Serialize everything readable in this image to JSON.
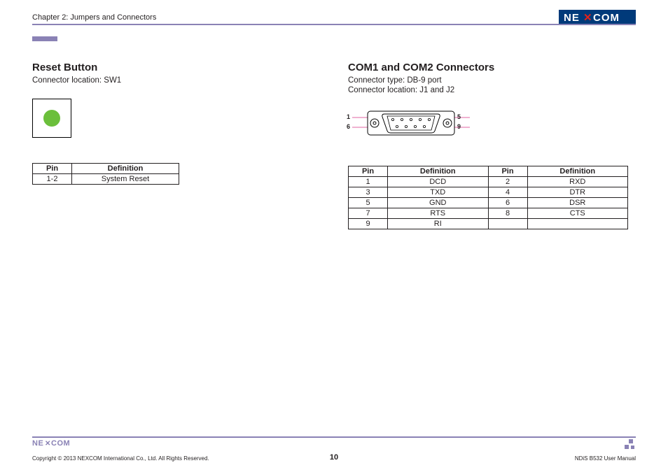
{
  "header": {
    "chapter": "Chapter 2: Jumpers and Connectors",
    "logo_text": "NEXCOM"
  },
  "left": {
    "title": "Reset Button",
    "meta1": "Connector location: SW1",
    "table": {
      "headers": [
        "Pin",
        "Definition"
      ],
      "rows": [
        {
          "pin": "1-2",
          "def": "System Reset"
        }
      ]
    }
  },
  "right": {
    "title": "COM1 and COM2 Connectors",
    "meta1": "Connector type: DB-9 port",
    "meta2": "Connector location: J1 and J2",
    "diagram_labels": {
      "tl": "1",
      "tr": "5",
      "bl": "6",
      "br": "9"
    },
    "table": {
      "headers": [
        "Pin",
        "Definition",
        "Pin",
        "Definition"
      ],
      "rows": [
        {
          "p1": "1",
          "d1": "DCD",
          "p2": "2",
          "d2": "RXD"
        },
        {
          "p1": "3",
          "d1": "TXD",
          "p2": "4",
          "d2": "DTR"
        },
        {
          "p1": "5",
          "d1": "GND",
          "p2": "6",
          "d2": "DSR"
        },
        {
          "p1": "7",
          "d1": "RTS",
          "p2": "8",
          "d2": "CTS"
        },
        {
          "p1": "9",
          "d1": "RI",
          "p2": "",
          "d2": ""
        }
      ]
    }
  },
  "footer": {
    "copyright": "Copyright © 2013 NEXCOM International Co., Ltd. All Rights Reserved.",
    "page": "10",
    "manual": "NDiS B532 User Manual"
  }
}
